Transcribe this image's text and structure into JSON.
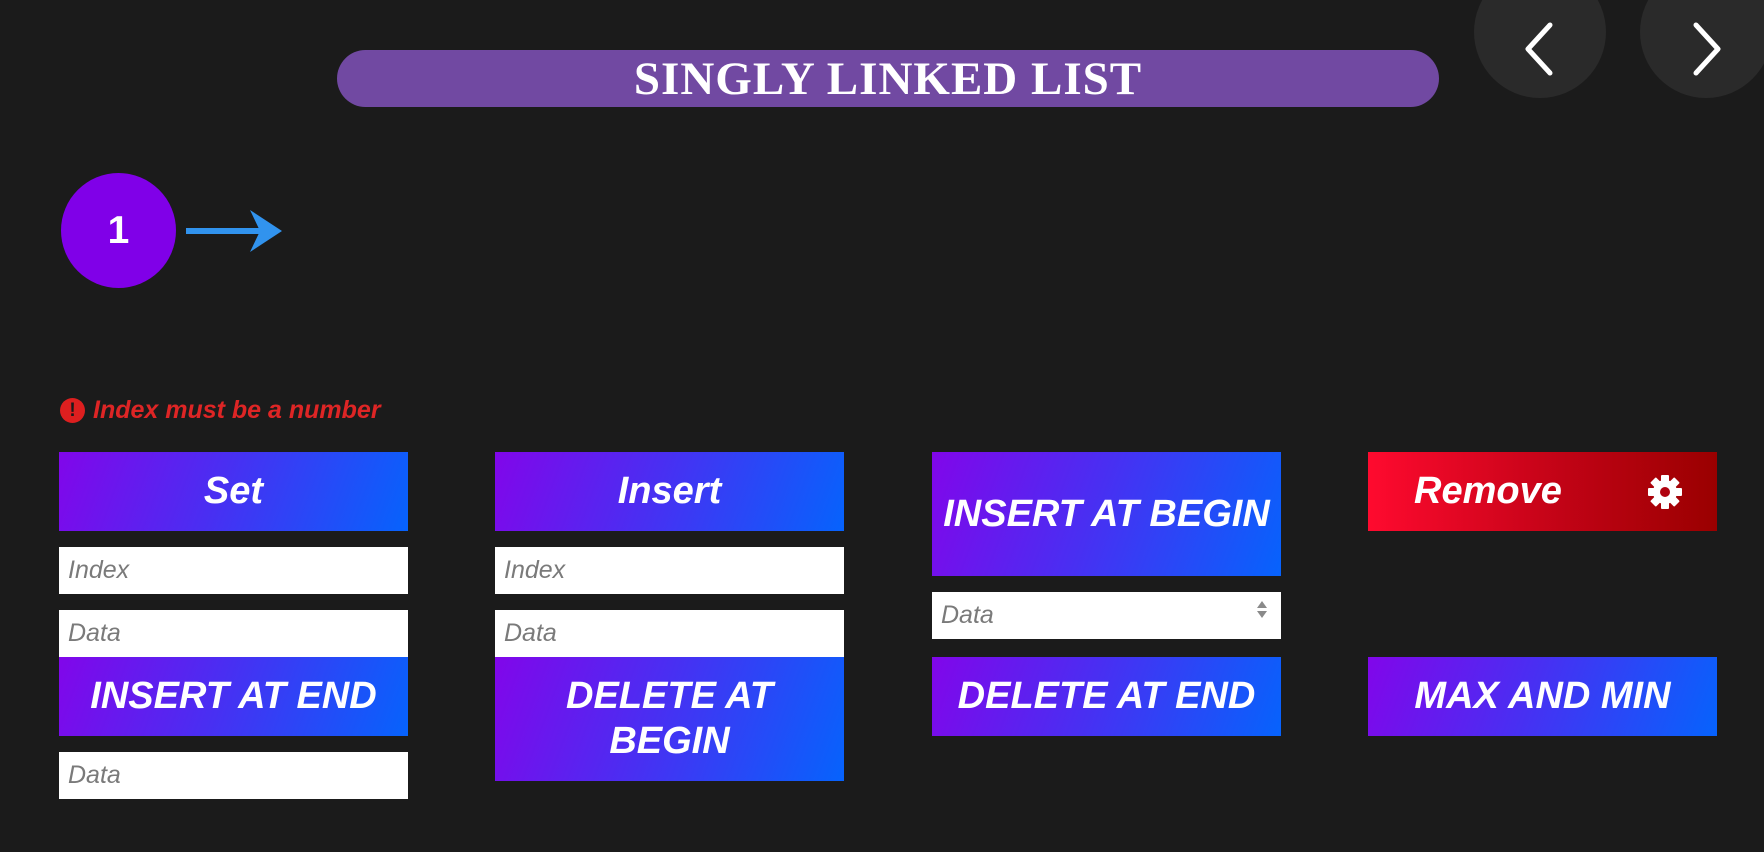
{
  "header": {
    "title": "SINGLY LINKED LIST",
    "prev_icon": "chevron-left-icon",
    "next_icon": "chevron-right-icon"
  },
  "list": {
    "nodes": [
      {
        "value": "1"
      }
    ],
    "arrow_color": "#3193ee",
    "node_color": "#8000e8"
  },
  "error": {
    "icon": "exclamation-circle-icon",
    "message": "Index must be a number",
    "color": "#de2525"
  },
  "set_panel": {
    "button_label": "Set",
    "index_placeholder": "Index",
    "data_placeholder": "Data"
  },
  "insert_panel": {
    "button_label": "Insert",
    "index_placeholder": "Index",
    "data_placeholder": "Data"
  },
  "insert_begin_panel": {
    "button_label": "INSERT AT BEGIN",
    "data_placeholder": "Data"
  },
  "remove_panel": {
    "button_label": "Remove",
    "icon": "gear-icon"
  },
  "insert_end_panel": {
    "button_label": "INSERT AT END",
    "data_placeholder": "Data"
  },
  "delete_begin_panel": {
    "button_label": "DELETE AT BEGIN"
  },
  "delete_end_panel": {
    "button_label": "DELETE AT END"
  },
  "max_min_panel": {
    "button_label": "MAX AND MIN"
  },
  "colors": {
    "background": "#1b1b1b",
    "title_bar": "#7149a2",
    "button_gradient_start": "#8106ea",
    "button_gradient_end": "#0663fc",
    "remove_gradient_start": "#ff0a2f",
    "remove_gradient_end": "#9a0000"
  }
}
